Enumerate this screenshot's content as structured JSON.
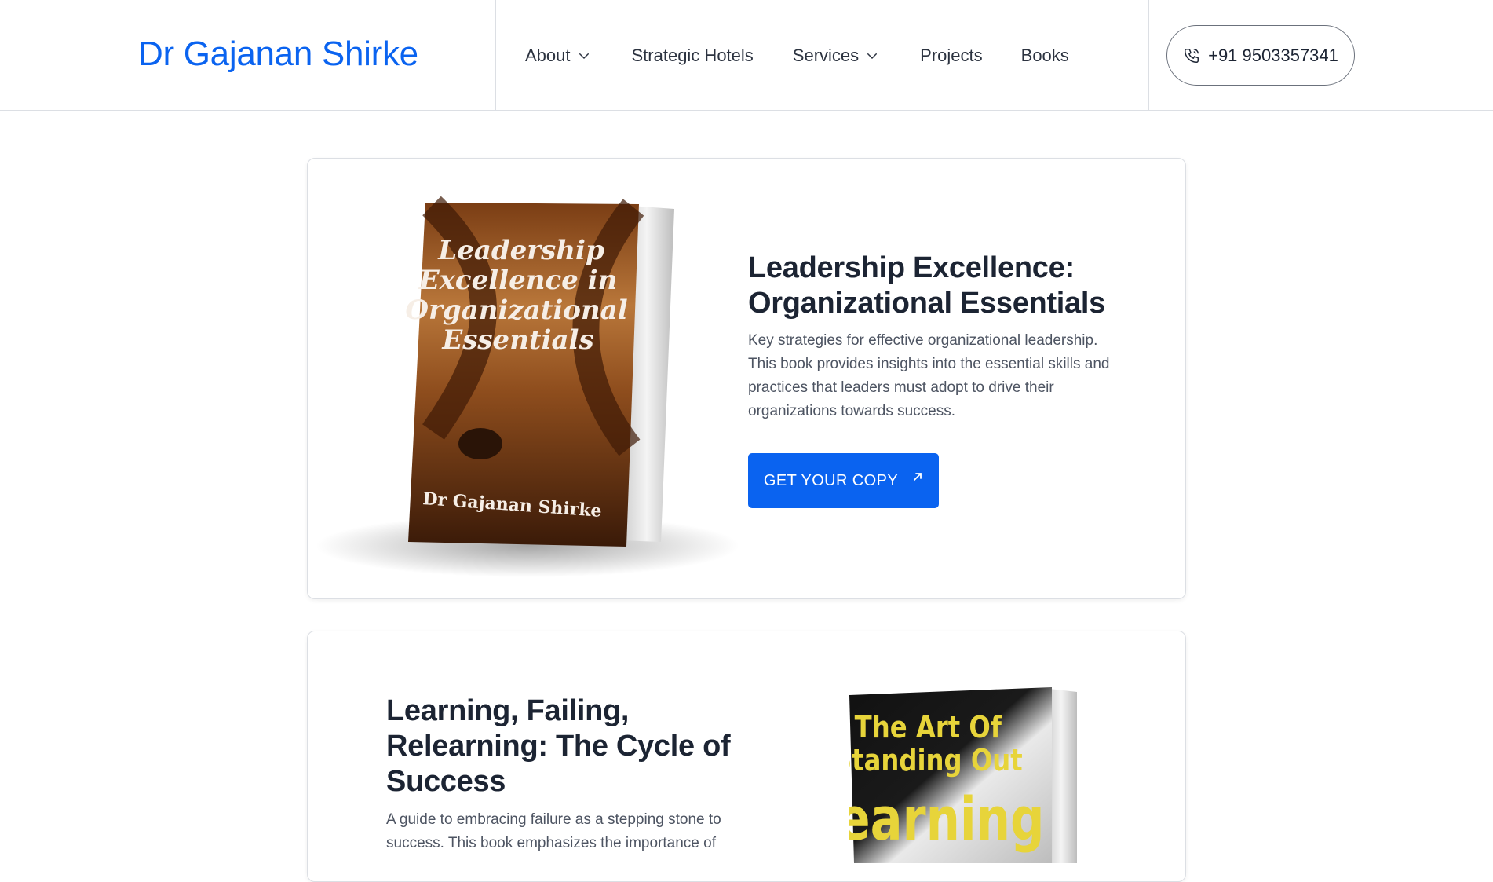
{
  "header": {
    "logo": "Dr Gajanan Shirke",
    "nav": [
      {
        "label": "About",
        "has_dropdown": true
      },
      {
        "label": "Strategic Hotels",
        "has_dropdown": false
      },
      {
        "label": "Services",
        "has_dropdown": true
      },
      {
        "label": "Projects",
        "has_dropdown": false
      },
      {
        "label": "Books",
        "has_dropdown": false
      }
    ],
    "phone": "+91 9503357341",
    "phone_icon": "phone-icon"
  },
  "books": [
    {
      "title": "Leadership Excellence: Organizational Essentials",
      "description": "Key strategies for effective organizational leadership. This book provides insights into the essential skills and practices that leaders must adopt to drive their organizations towards success.",
      "cta": "GET YOUR COPY",
      "cta_icon": "arrow-up-right-icon",
      "cover": {
        "lines": [
          "Leadership",
          "Excellence in",
          "Organizational",
          "Essentials"
        ],
        "author": "Dr Gajanan Shirke"
      }
    },
    {
      "title": "Learning, Failing, Relearning: The Cycle of Success",
      "description": "A guide to embracing failure as a stepping stone to success. This book emphasizes the importance of",
      "cover": {
        "lines": [
          "The Art Of",
          "Standing Out",
          "Learning"
        ]
      }
    }
  ],
  "colors": {
    "accent": "#0a63f0",
    "text": "#1c2433",
    "border": "#dcdfe4"
  }
}
